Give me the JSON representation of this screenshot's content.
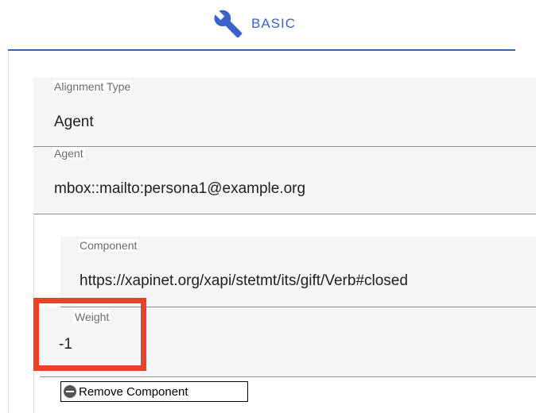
{
  "tab": {
    "label": "BASIC",
    "icon": "wrench-icon",
    "color": "#3a63c9"
  },
  "fields": {
    "alignment_type": {
      "label": "Alignment Type",
      "value": "Agent"
    },
    "agent": {
      "label": "Agent",
      "value": "mbox::mailto:persona1@example.org"
    },
    "component": {
      "label": "Component",
      "value": "https://xapinet.org/xapi/stetmt/its/gift/Verb#closed"
    },
    "weight": {
      "label": "Weight",
      "value": "-1"
    }
  },
  "remove_component": {
    "label": "Remove Component",
    "icon": "minus-circle-icon"
  },
  "highlight_color": "#e8412c"
}
